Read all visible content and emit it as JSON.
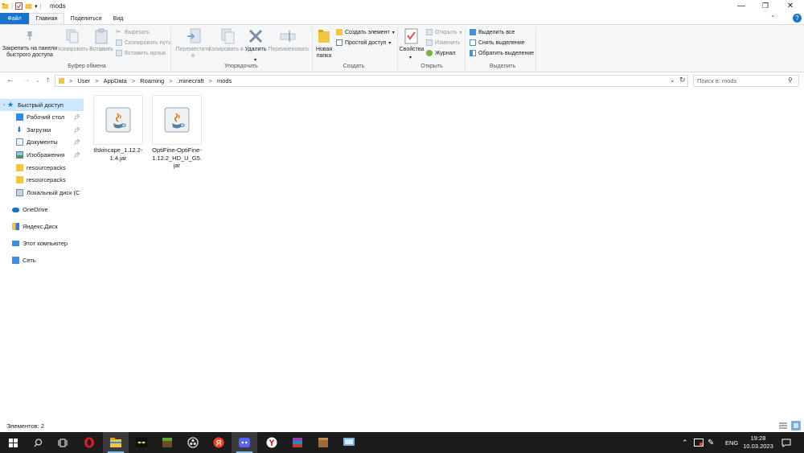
{
  "window": {
    "title": "mods",
    "controls": {
      "minimize": "—",
      "maximize": "❐",
      "close": "✕"
    },
    "qa_dropdown": "▾"
  },
  "ribbon_tabs": {
    "file": "Файл",
    "home": "Главная",
    "share": "Поделиться",
    "view": "Вид"
  },
  "ribbon": {
    "clipboard": {
      "pin": "Закрепить на панели быстрого доступа",
      "copy": "Копировать",
      "paste": "Вставить",
      "cut": "Вырезать",
      "copy_path": "Скопировать путь",
      "paste_shortcut": "Вставить ярлык",
      "label": "Буфер обмена"
    },
    "organize": {
      "move_to": "Переместить в",
      "copy_to": "Копировать в",
      "delete": "Удалить",
      "rename": "Переименовать",
      "label": "Упорядочить"
    },
    "new": {
      "new_folder": "Новая папка",
      "new_item": "Создать элемент",
      "easy_access": "Простой доступ",
      "label": "Создать"
    },
    "open": {
      "properties": "Свойства",
      "open": "Открыть",
      "edit": "Изменить",
      "history": "Журнал",
      "label": "Открыть"
    },
    "select": {
      "select_all": "Выделить все",
      "select_none": "Снять выделение",
      "invert": "Обратить выделение",
      "label": "Выделить"
    }
  },
  "address": {
    "crumbs": [
      "User",
      "AppData",
      "Roaming",
      ".minecraft",
      "mods"
    ],
    "separator": ">",
    "search_placeholder": "Поиск в: mods"
  },
  "nav": {
    "quick_access": "Быстрый доступ",
    "desktop": "Рабочий стол",
    "downloads": "Загрузки",
    "documents": "Документы",
    "pictures": "Изображения",
    "resourcepacks_1": "resourcepacks",
    "resourcepacks_2": "resourcepacks",
    "local_disk": "Локальный диск (С",
    "onedrive": "OneDrive",
    "yandex_disk": "Яндекс.Диск",
    "this_pc": "Этот компьютер",
    "network": "Сеть"
  },
  "files": [
    {
      "name": "tlskincape_1.12.2-1.4.jar"
    },
    {
      "name": "OptiFine-OptiFine-1.12.2_HD_U_G5.jar"
    }
  ],
  "status": {
    "items_count": "Элементов: 2"
  },
  "taskbar": {
    "lang": "ENG",
    "time": "19:28",
    "date": "10.03.2023"
  },
  "colors": {
    "accent": "#1a73c9",
    "selection": "#cce8ff",
    "folder": "#f4c542",
    "taskbar": "#1c1c1c"
  }
}
